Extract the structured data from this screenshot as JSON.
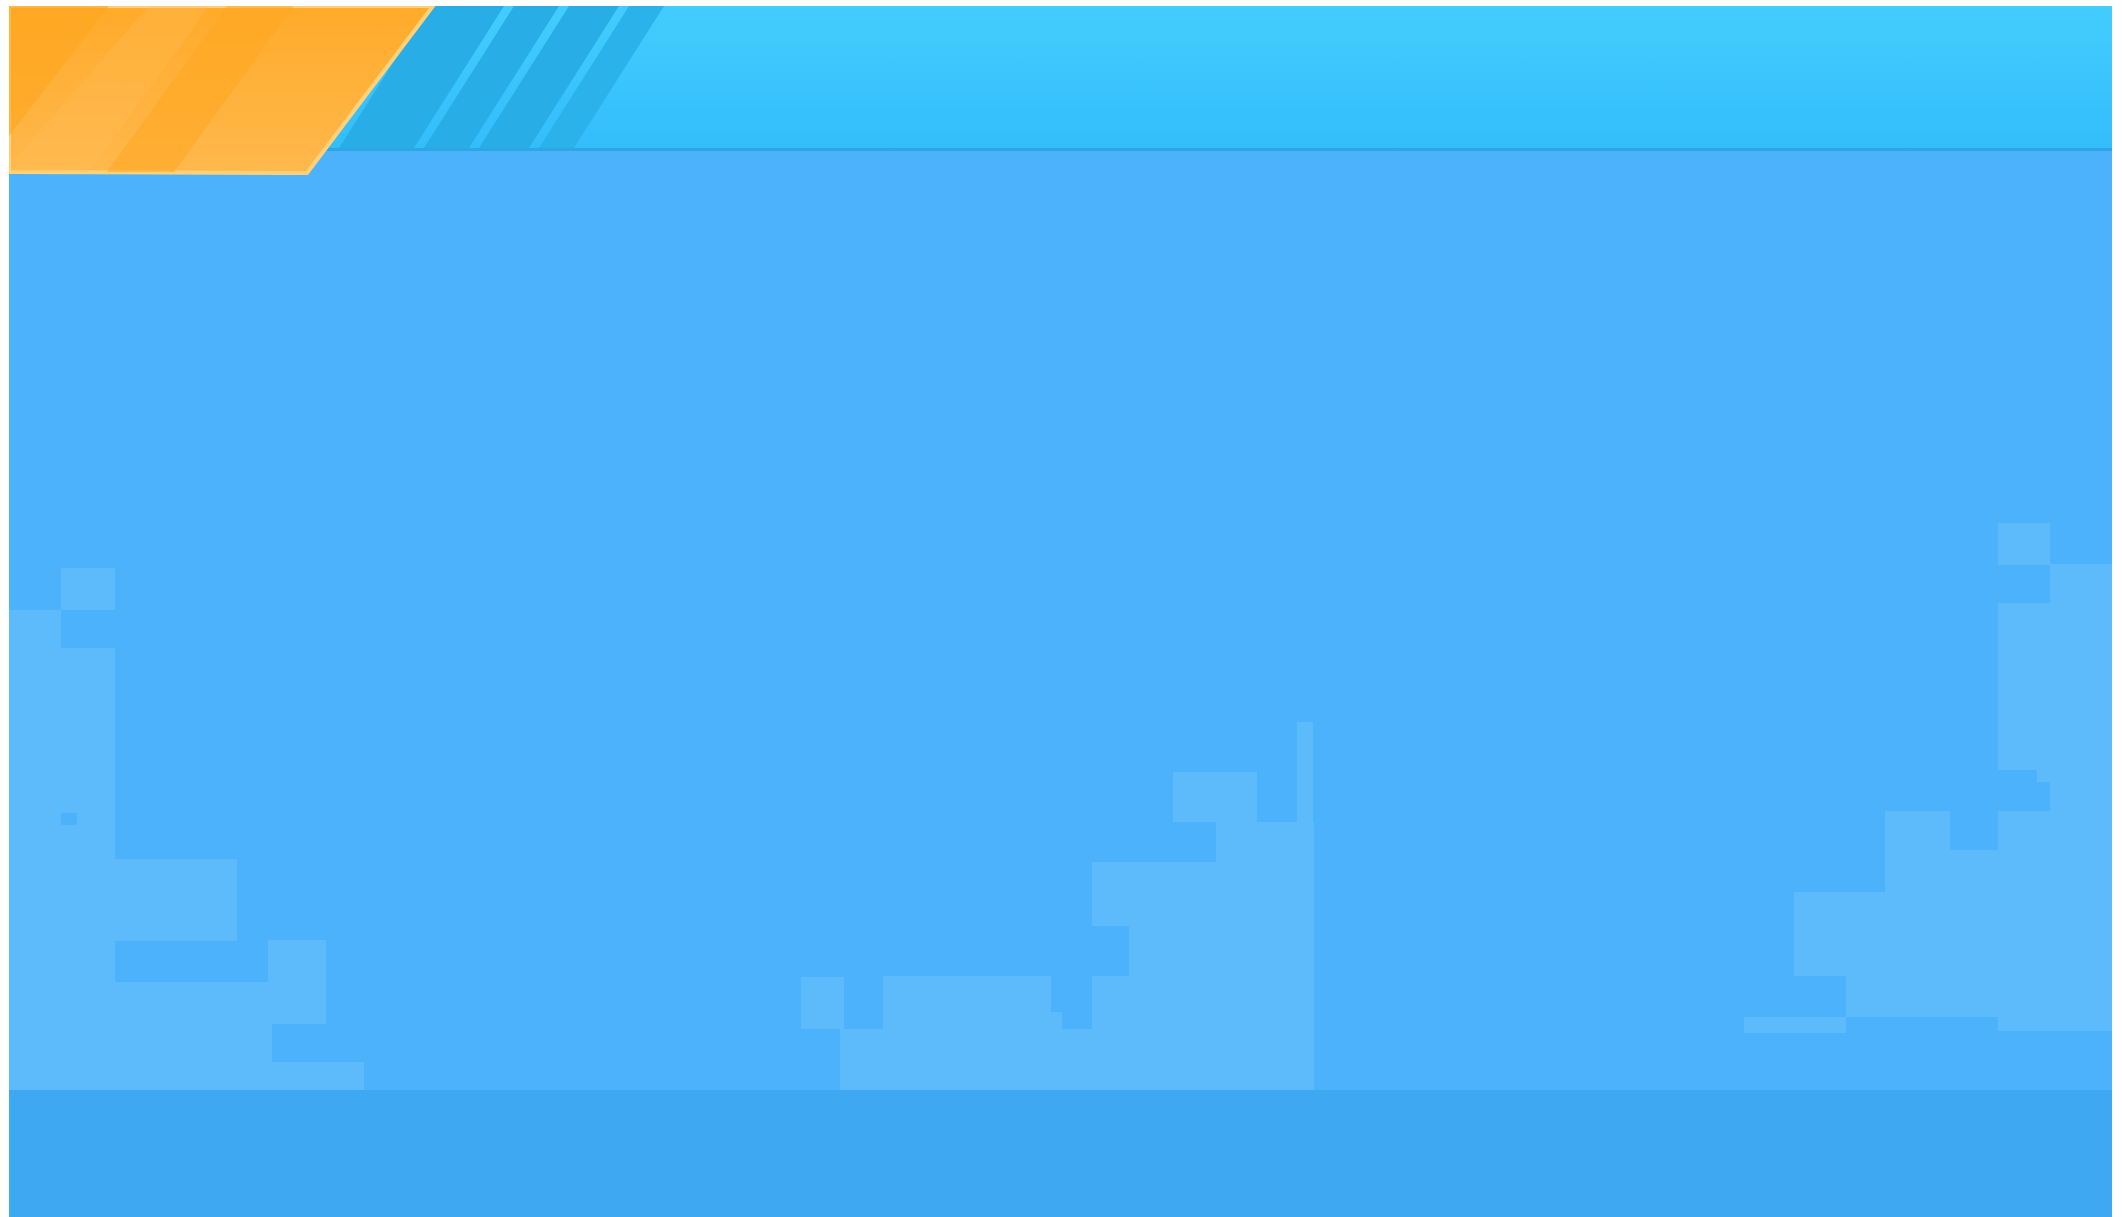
{
  "scene": {
    "name": "game-level-background",
    "header": {
      "banner_text": ""
    },
    "colors": {
      "sky": "#4cb2fc",
      "header_bar": "#3bc5fc",
      "header_stripes": "#29ade6",
      "silhouettes": "#5dbbfc",
      "ground": "#3ea9f2",
      "banner_orange": "#ffb23e",
      "banner_outline": "#ffd27a"
    },
    "silhouettes": [
      "left-rock-formation",
      "center-ruins",
      "right-cliff-formation"
    ]
  }
}
